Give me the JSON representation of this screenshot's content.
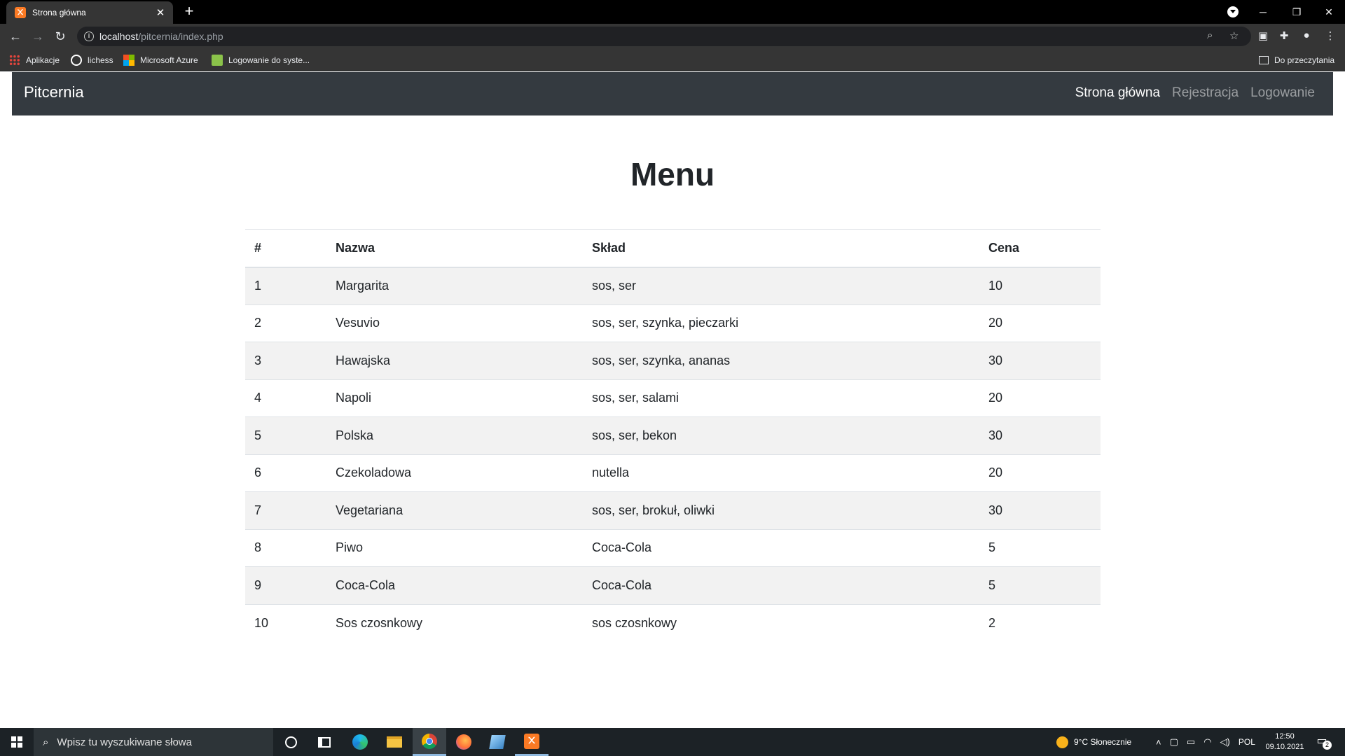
{
  "browser": {
    "tab_title": "Strona główna",
    "tab_favicon_text": "᙭",
    "url_host": "localhost",
    "url_path": "/pitcernia/index.php",
    "bookmarks": [
      {
        "label": "Aplikacje",
        "icon": "apps-grid-icon"
      },
      {
        "label": "lichess",
        "icon": "lichess-icon"
      },
      {
        "label": "Microsoft Azure",
        "icon": "microsoft-icon"
      },
      {
        "label": "Logowanie do syste...",
        "icon": "login-site-icon"
      }
    ],
    "reading_list": "Do przeczytania"
  },
  "navbar": {
    "brand": "Pitcernia",
    "links": [
      {
        "label": "Strona główna",
        "active": true
      },
      {
        "label": "Rejestracja",
        "active": false
      },
      {
        "label": "Logowanie",
        "active": false
      }
    ]
  },
  "main": {
    "heading": "Menu",
    "table": {
      "headers": [
        "#",
        "Nazwa",
        "Skład",
        "Cena"
      ],
      "rows": [
        [
          "1",
          "Margarita",
          "sos, ser",
          "10"
        ],
        [
          "2",
          "Vesuvio",
          "sos, ser, szynka, pieczarki",
          "20"
        ],
        [
          "3",
          "Hawajska",
          "sos, ser, szynka, ananas",
          "30"
        ],
        [
          "4",
          "Napoli",
          "sos, ser, salami",
          "20"
        ],
        [
          "5",
          "Polska",
          "sos, ser, bekon",
          "30"
        ],
        [
          "6",
          "Czekoladowa",
          "nutella",
          "20"
        ],
        [
          "7",
          "Vegetariana",
          "sos, ser, brokuł, oliwki",
          "30"
        ],
        [
          "8",
          "Piwo",
          "Coca-Cola",
          "5"
        ],
        [
          "9",
          "Coca-Cola",
          "Coca-Cola",
          "5"
        ],
        [
          "10",
          "Sos czosnkowy",
          "sos czosnkowy",
          "2"
        ]
      ]
    }
  },
  "taskbar": {
    "search_placeholder": "Wpisz tu wyszukiwane słowa",
    "weather": "9°C  Słonecznie",
    "language": "POL",
    "time": "12:50",
    "date": "09.10.2021",
    "notification_count": "2"
  },
  "colors": {
    "navbar_bg": "#343a40",
    "xampp_orange": "#fb7a24",
    "taskbar_bg": "#1c2226"
  }
}
